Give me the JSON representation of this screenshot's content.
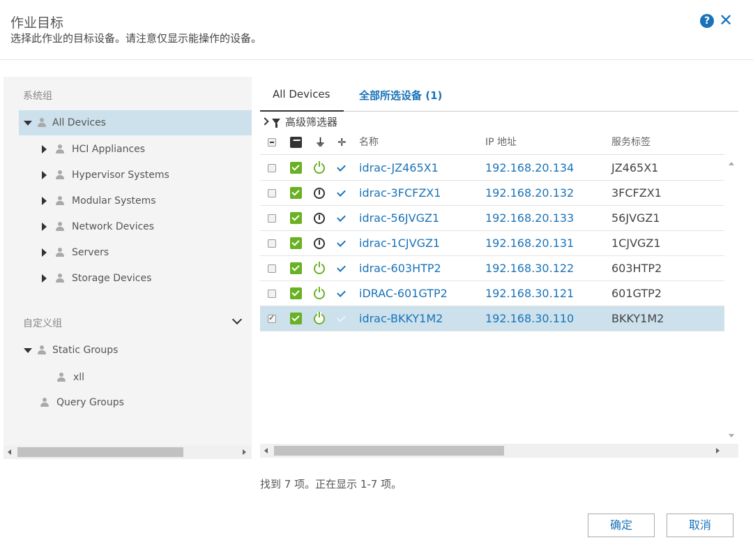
{
  "dialog": {
    "title": "作业目标",
    "subtitle": "选择此作业的目标设备。请注意仅显示能操作的设备。",
    "help_icon": "?",
    "close_icon": "✕"
  },
  "left": {
    "system_groups_label": "系统组",
    "system_tree": [
      {
        "label": "All Devices",
        "selected": true
      },
      {
        "label": "HCI Appliances"
      },
      {
        "label": "Hypervisor Systems"
      },
      {
        "label": "Modular Systems"
      },
      {
        "label": "Network Devices"
      },
      {
        "label": "Servers"
      },
      {
        "label": "Storage Devices"
      }
    ],
    "custom_groups_label": "自定义组",
    "custom_tree": [
      {
        "label": "Static Groups"
      },
      {
        "label": "xll"
      },
      {
        "label": "Query Groups"
      }
    ]
  },
  "tabs": {
    "all_devices": "All Devices",
    "selected_devices": "全部所选设备 (1)"
  },
  "filter": {
    "label": "高级筛选器"
  },
  "table": {
    "columns": {
      "name": "名称",
      "ip": "IP 地址",
      "service_tag": "服务标签"
    },
    "rows": [
      {
        "name": "idrac-JZ465X1",
        "ip": "192.168.20.134",
        "tag": "JZ465X1",
        "power": "on",
        "checked": false
      },
      {
        "name": "idrac-3FCFZX1",
        "ip": "192.168.20.132",
        "tag": "3FCFZX1",
        "power": "off",
        "checked": false
      },
      {
        "name": "idrac-56JVGZ1",
        "ip": "192.168.20.133",
        "tag": "56JVGZ1",
        "power": "off",
        "checked": false
      },
      {
        "name": "idrac-1CJVGZ1",
        "ip": "192.168.20.131",
        "tag": "1CJVGZ1",
        "power": "off",
        "checked": false
      },
      {
        "name": "idrac-603HTP2",
        "ip": "192.168.30.122",
        "tag": "603HTP2",
        "power": "on",
        "checked": false
      },
      {
        "name": "iDRAC-601GTP2",
        "ip": "192.168.30.121",
        "tag": "601GTP2",
        "power": "on",
        "checked": false
      },
      {
        "name": "idrac-BKKY1M2",
        "ip": "192.168.30.110",
        "tag": "BKKY1M2",
        "power": "on",
        "checked": true
      }
    ]
  },
  "footer": {
    "status": "找到 7 项。正在显示 1-7 项。",
    "ok_label": "确定",
    "cancel_label": "取消"
  },
  "colors": {
    "accent": "#1a73b8",
    "status_green": "#6ab023",
    "selection": "#cce1ec"
  }
}
